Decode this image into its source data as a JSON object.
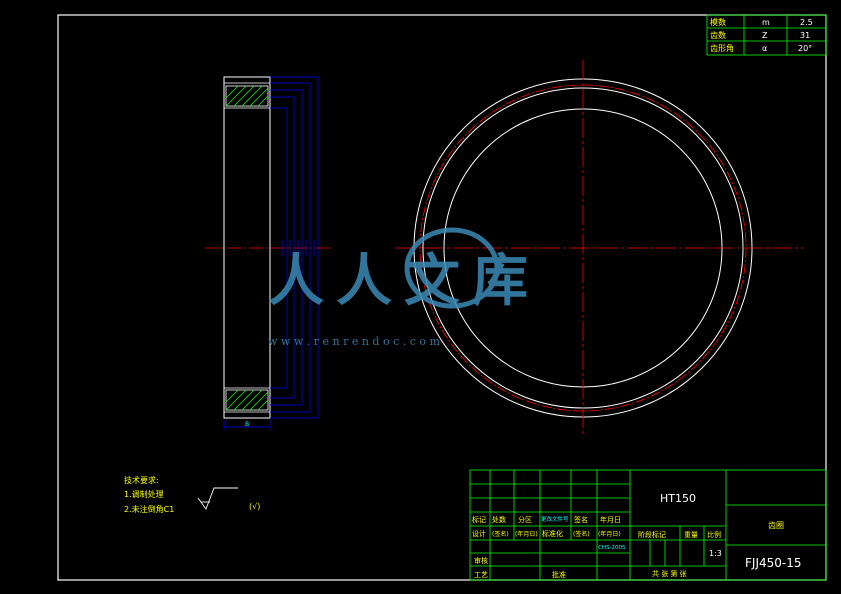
{
  "gear_params": {
    "rows": [
      {
        "name": "模数",
        "symbol": "m",
        "value": "2.5"
      },
      {
        "name": "齿数",
        "symbol": "Z",
        "value": "31"
      },
      {
        "name": "齿形角",
        "symbol": "α",
        "value": "20°"
      }
    ]
  },
  "tech_notes": {
    "title": "技术要求:",
    "items": [
      "1.调制处理",
      "2.未注倒角C1"
    ]
  },
  "roughness_mark": "(√)",
  "dimension_label": "B",
  "title_block": {
    "material": "HT150",
    "part_name": "齿圈",
    "drawing_number": "FJJ450-15",
    "scale": "1:3",
    "row_labels": [
      "标记",
      "处数",
      "分区",
      "更改文件号",
      "签名",
      "年月日"
    ],
    "design_row": [
      "设计",
      "(签名)",
      "(年月日)",
      "标准化",
      "(签名)",
      "(年月日)"
    ],
    "stage_label": "阶段标记",
    "weight_label": "重量",
    "scale_label": "比例",
    "review_label": "审核",
    "process_label": "工艺",
    "approve_label": "批准",
    "sheets_label": "共 张 第 张",
    "small_tag": "CHS-2005"
  },
  "watermark": {
    "brand": "人人文库",
    "url": "w w w . r e n r e n d o c . c o m"
  },
  "colors": {
    "border": "#ffffff",
    "title_lines": "#00ff00",
    "dimension": "#0000ff",
    "centerline": "#ff0000",
    "hatch": "#00ff00",
    "watermark": "#3b8ab6"
  }
}
